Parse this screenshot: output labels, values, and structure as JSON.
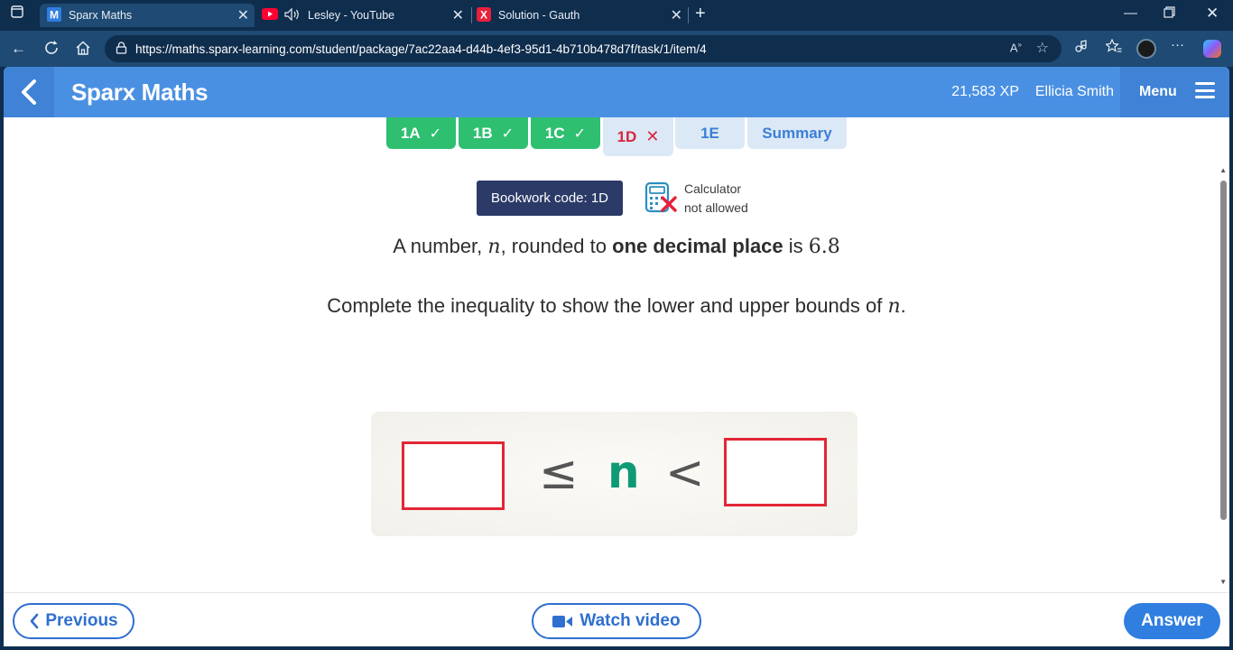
{
  "browser": {
    "tabs": [
      {
        "title": "Sparx Maths",
        "favicon": "sparx-m-icon"
      },
      {
        "title": "Lesley - YouTube",
        "favicon": "youtube-icon"
      },
      {
        "title": "Solution - Gauth",
        "favicon": "gauth-icon"
      }
    ],
    "url": "https://maths.sparx-learning.com/student/package/7ac22aa4-d44b-4ef3-95d1-4b710b478d7f/task/1/item/4"
  },
  "header": {
    "title": "Sparx Maths",
    "xp": "21,583 XP",
    "user": "Ellicia Smith",
    "menu_label": "Menu"
  },
  "task_tabs": [
    {
      "label": "1A",
      "status": "done"
    },
    {
      "label": "1B",
      "status": "done"
    },
    {
      "label": "1C",
      "status": "done"
    },
    {
      "label": "1D",
      "status": "wrong"
    },
    {
      "label": "1E",
      "status": "todo"
    },
    {
      "label": "Summary",
      "status": "todo"
    }
  ],
  "bookwork": {
    "label": "Bookwork code: 1D"
  },
  "calculator": {
    "line1": "Calculator",
    "line2": "not allowed"
  },
  "question": {
    "l1_a": "A number, ",
    "l1_var": "n",
    "l1_b": ", rounded to ",
    "l1_bold": "one decimal place",
    "l1_c": " is ",
    "l1_num": "6.8",
    "l2_a": "Complete the inequality to show the lower and upper bounds of ",
    "l2_var": "n",
    "l2_b": "."
  },
  "inequality": {
    "leq": "≤",
    "var": "n",
    "lt": "<",
    "lower_value": "",
    "upper_value": ""
  },
  "footer": {
    "previous": "Previous",
    "watch": "Watch video",
    "answer": "Answer"
  },
  "colors": {
    "header_blue": "#4a90e2",
    "done_green": "#2fbf71",
    "wrong_red": "#d9263b",
    "answer_box_red": "#e32636",
    "n_green": "#0e9a74",
    "bookwork_navy": "#2b3a67"
  }
}
